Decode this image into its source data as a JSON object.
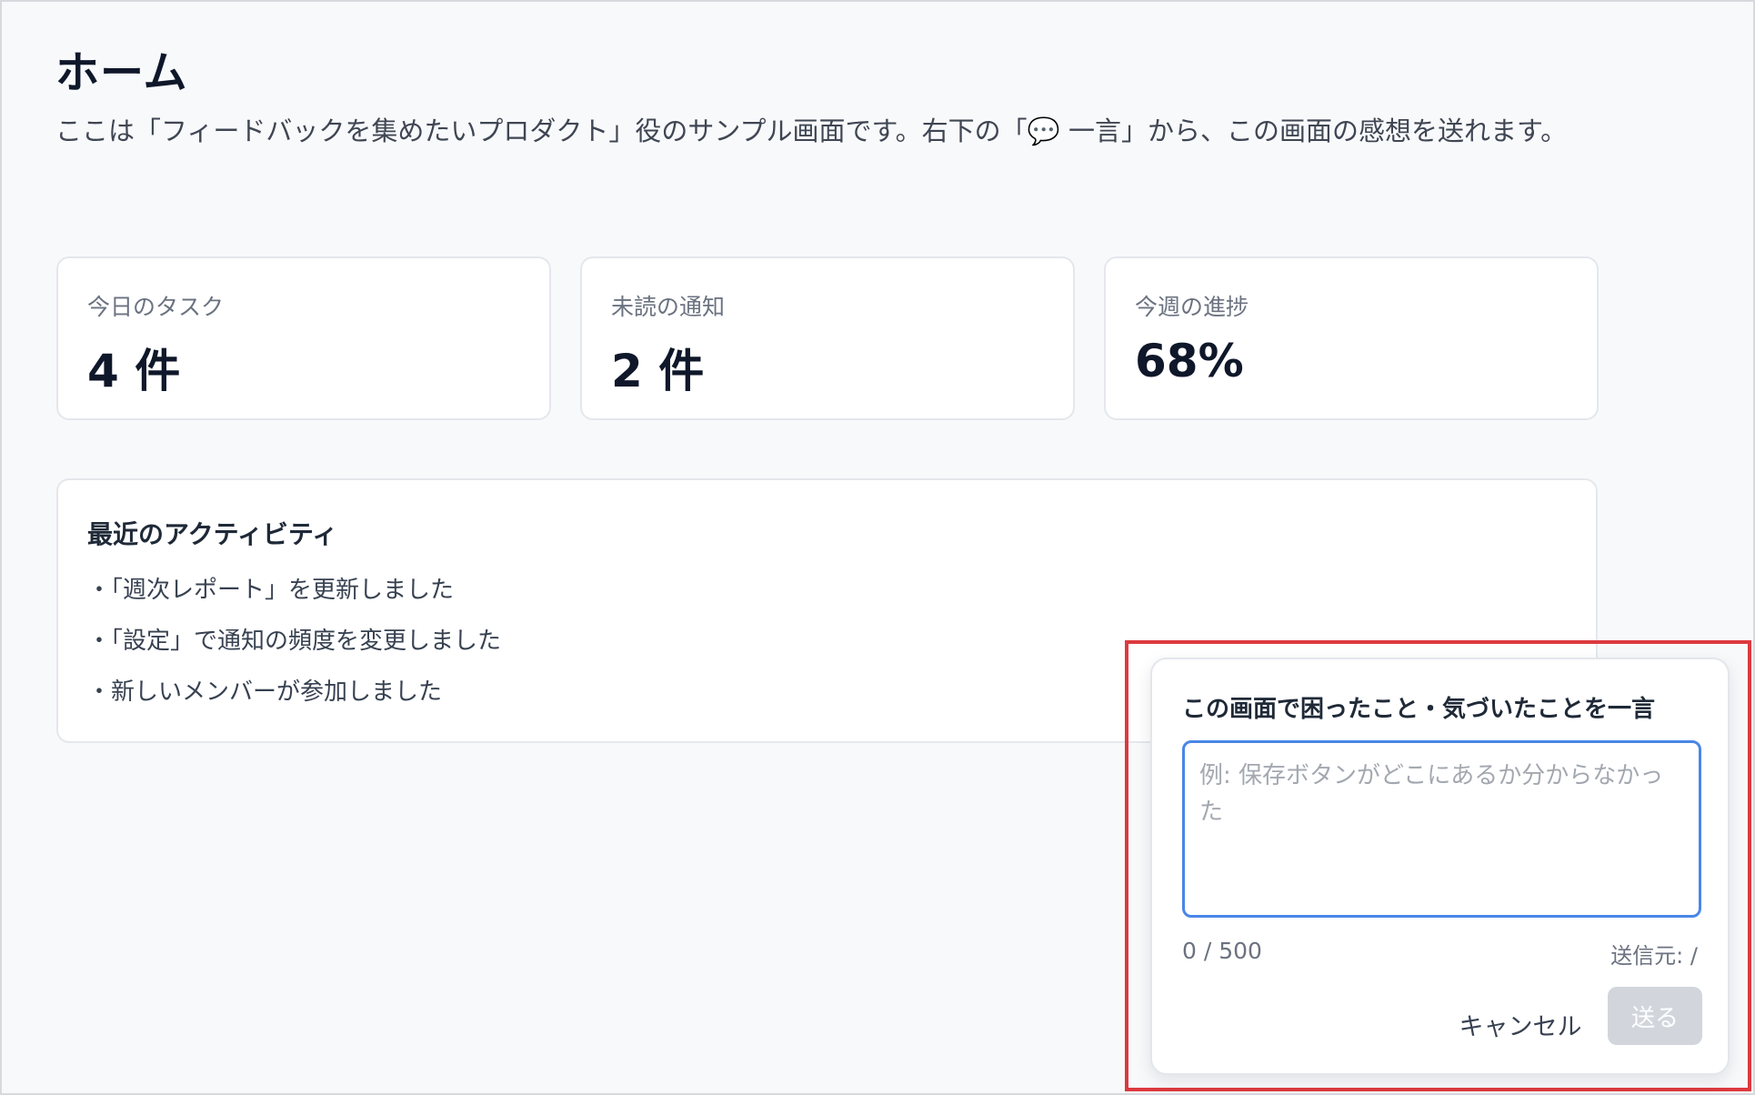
{
  "page": {
    "title": "ホーム",
    "description": "ここは「フィードバックを集めたいプロダクト」役のサンプル画面です。右下の「💬 一言」から、この画面の感想を送れます。"
  },
  "stats": [
    {
      "label": "今日のタスク",
      "value": "4 件"
    },
    {
      "label": "未読の通知",
      "value": "2 件"
    },
    {
      "label": "今週の進捗",
      "value": "68%"
    }
  ],
  "activity": {
    "title": "最近のアクティビティ",
    "items": [
      "・「週次レポート」を更新しました",
      "・「設定」で通知の頻度を変更しました",
      "・新しいメンバーが参加しました"
    ]
  },
  "feedback": {
    "title": "この画面で困ったこと・気づいたことを一言",
    "input_value": "",
    "placeholder": "例: 保存ボタンがどこにあるか分からなかった",
    "counter": "0 / 500",
    "sender": "送信元: /",
    "cancel_label": "キャンセル",
    "send_label": "送る"
  },
  "colors": {
    "accent_focus": "#4a86e8",
    "highlight_border": "#dc3a3f",
    "disabled_button": "#d2d6dc"
  }
}
